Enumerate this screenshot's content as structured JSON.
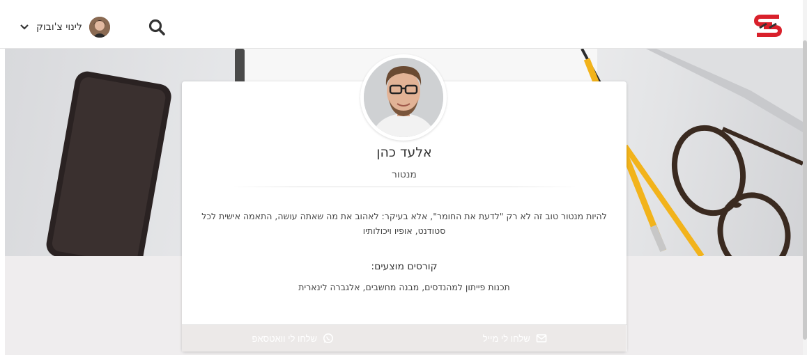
{
  "header": {
    "user_name": "לינוי צ'ובוק",
    "icons": [
      "chevron-down-icon",
      "avatar",
      "search-icon",
      "site-logo"
    ],
    "logo_color": "#d9202b"
  },
  "mentor": {
    "name": "אלעד כהן",
    "role": "מנטור",
    "bio": "להיות מנטור טוב זה לא רק \"לדעת את החומר\", אלא בעיקר: לאהוב את מה שאתה עושה, התאמה אישית לכל סטודנט, אופיו ויכולותיו",
    "courses_title": "קורסים מוצעים:",
    "courses": "תכנות פייתון למהנדסים, מבנה מחשבים, אלגברה לינארית"
  },
  "actions": {
    "mail_label": "שלחו לי מייל",
    "whatsapp_label": "שלחו לי וואטסאפ"
  },
  "colors": {
    "accent": "#d9202b",
    "button_bg": "#ece9e8",
    "button_text": "#ffffff"
  }
}
